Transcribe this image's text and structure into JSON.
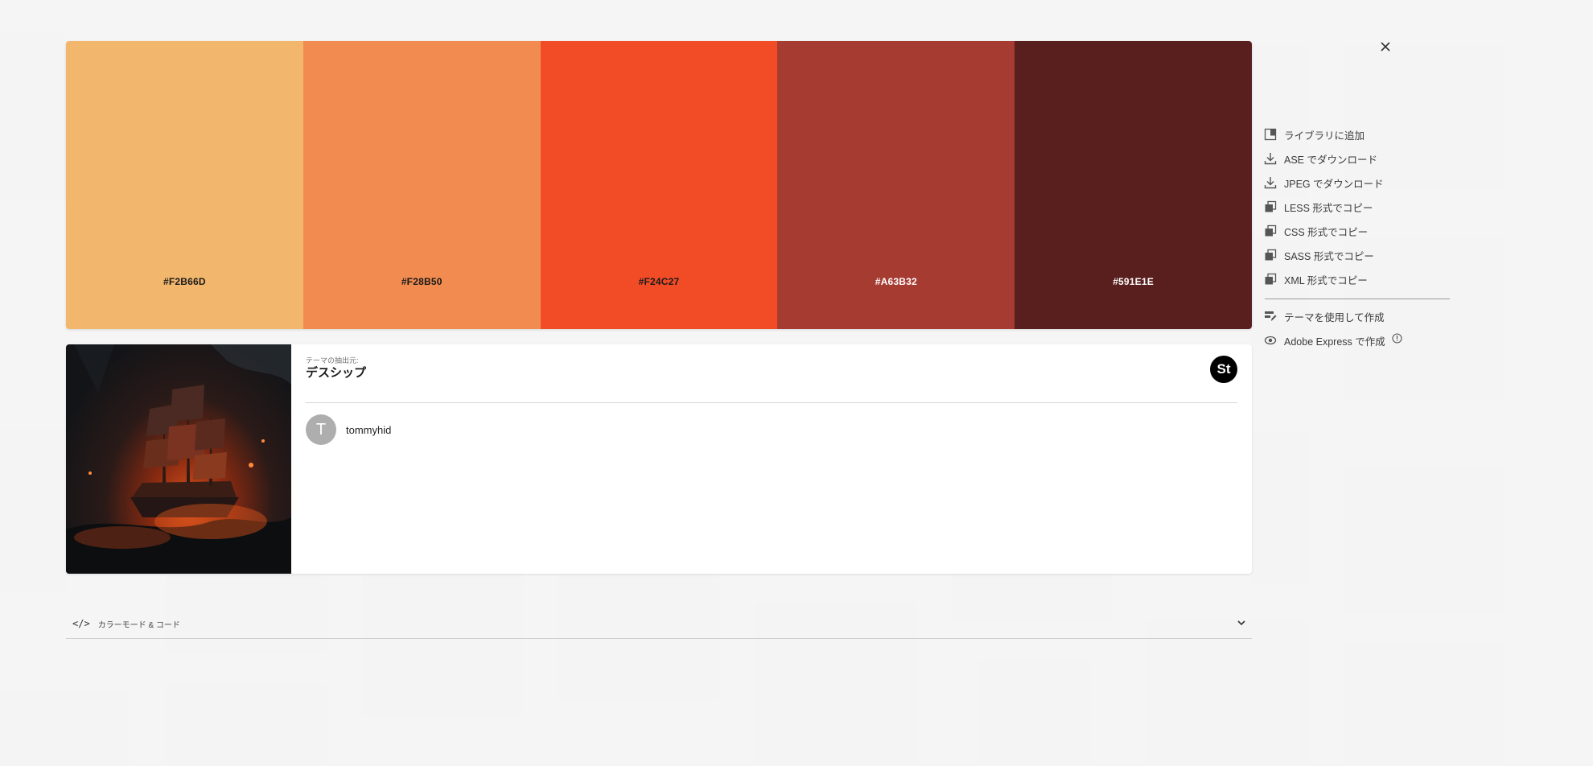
{
  "palette": {
    "swatches": [
      {
        "hex": "#F2B66D",
        "label_color": "#1a1a1a"
      },
      {
        "hex": "#F28B50",
        "label_color": "#1a1a1a"
      },
      {
        "hex": "#F24C27",
        "label_color": "#1a1a1a"
      },
      {
        "hex": "#A63B32",
        "label_color": "#ffffff"
      },
      {
        "hex": "#591E1E",
        "label_color": "#ffffff"
      }
    ]
  },
  "source": {
    "label": "テーマの抽出元:",
    "title": "デスシップ",
    "badge": "St",
    "image_icon": "pirate-ship-image"
  },
  "author": {
    "initial": "T",
    "name": "tommyhid"
  },
  "accordion": {
    "icon": "</>",
    "label": "カラーモード & コード"
  },
  "actions": [
    {
      "label": "ライブラリに追加",
      "icon": "library-icon"
    },
    {
      "label": "ASE でダウンロード",
      "icon": "download-icon"
    },
    {
      "label": "JPEG でダウンロード",
      "icon": "download-icon"
    },
    {
      "label": "LESS 形式でコピー",
      "icon": "copy-icon"
    },
    {
      "label": "CSS 形式でコピー",
      "icon": "copy-icon"
    },
    {
      "label": "SASS 形式でコピー",
      "icon": "copy-icon"
    },
    {
      "label": "XML 形式でコピー",
      "icon": "copy-icon"
    }
  ],
  "extra_actions": [
    {
      "label": "テーマを使用して作成",
      "icon": "edit-theme-icon"
    },
    {
      "label": "Adobe Express で作成",
      "icon": "adobe-express-icon"
    }
  ]
}
